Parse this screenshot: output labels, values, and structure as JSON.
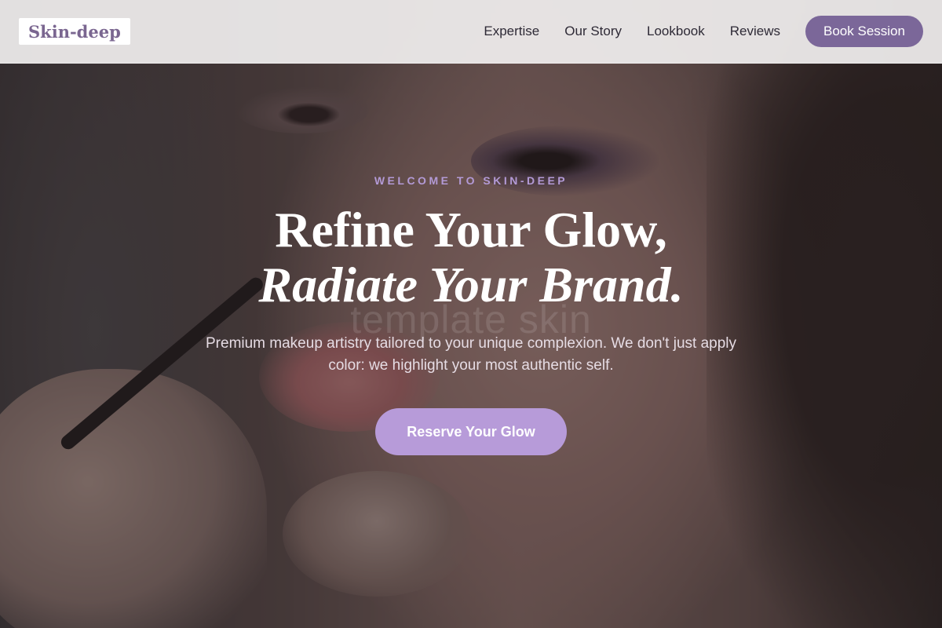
{
  "brand": {
    "logo_text": "Skin-deep"
  },
  "nav": {
    "links": [
      {
        "label": "Expertise"
      },
      {
        "label": "Our Story"
      },
      {
        "label": "Lookbook"
      },
      {
        "label": "Reviews"
      }
    ],
    "cta_label": "Book Session"
  },
  "hero": {
    "eyebrow": "WELCOME TO SKIN-DEEP",
    "headline_line1": "Refine Your Glow,",
    "headline_line2": "Radiate Your Brand.",
    "watermark": "template skin",
    "subtext": "Premium makeup artistry tailored to your unique complexion. We don't just apply color: we highlight your most authentic self.",
    "cta_label": "Reserve Your Glow"
  },
  "colors": {
    "accent": "#7b6799",
    "cta_light": "#b79bd9",
    "eyebrow": "#b39ad6"
  }
}
